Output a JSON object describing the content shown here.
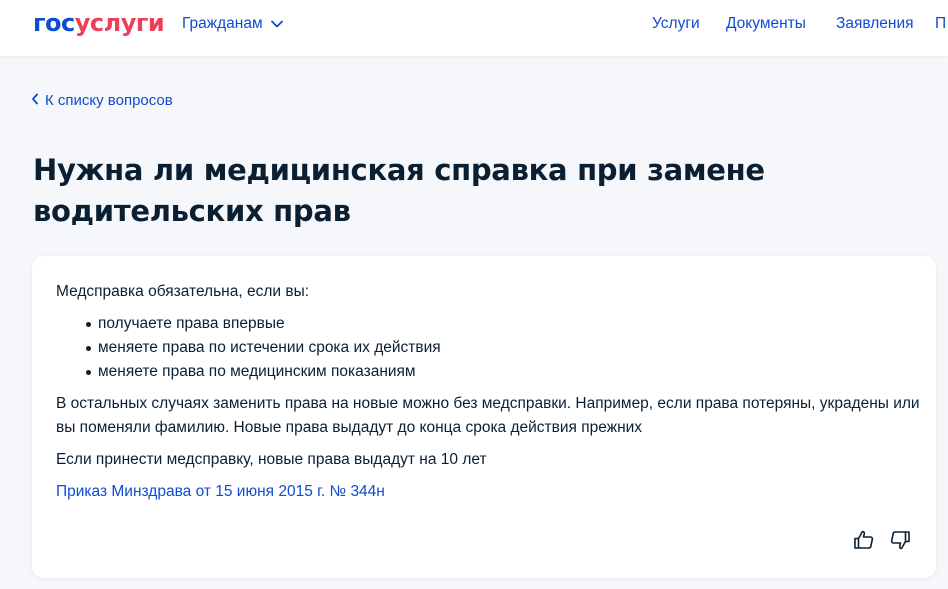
{
  "header": {
    "logo_part1": "гос",
    "logo_part2": "услуги",
    "citizens_label": "Гражданам",
    "nav": [
      "Услуги",
      "Документы",
      "Заявления",
      "П"
    ]
  },
  "breadcrumb": {
    "back_label": "К списку вопросов"
  },
  "page_title": "Нужна ли медицинская справка при замене водительских прав",
  "answer": {
    "intro": "Медсправка обязательна, если вы:",
    "bullets": [
      "получаете права впервые",
      "меняете права по истечении срока их действия",
      "меняете права по медицинским показаниям"
    ],
    "paragraph1": "В остальных случаях заменить права на новые можно без медсправки. Например, если права потеряны, украдены или вы поменяли фамилию. Новые права выдадут до конца срока действия прежних",
    "paragraph2": "Если принести медсправку, новые права выдадут на 10 лет",
    "link": "Приказ Минздрава от 15 июня 2015 г. № 344н"
  },
  "feedback": {
    "like_icon": "thumbs-up-icon",
    "dislike_icon": "thumbs-down-icon"
  },
  "colors": {
    "primary": "#0d4cd3",
    "logo_accent": "#ee3f58",
    "text": "#0b1f33",
    "background": "#f5f7fa"
  }
}
